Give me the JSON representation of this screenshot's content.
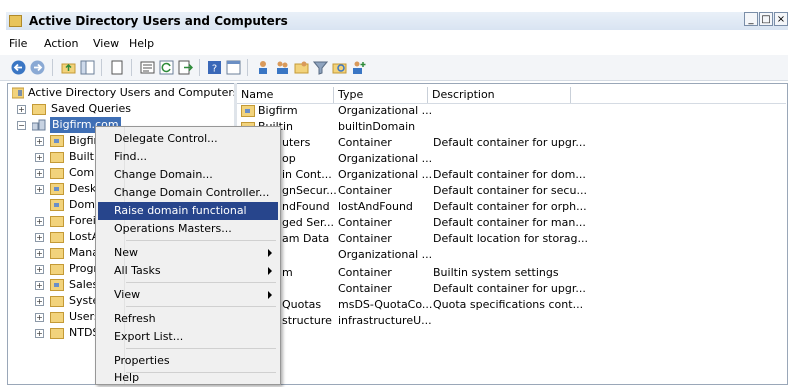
{
  "window": {
    "title": "Active Directory Users and Computers",
    "buttons": [
      "_",
      "□",
      "×"
    ]
  },
  "menubar": {
    "items": [
      "File",
      "Action",
      "View",
      "Help"
    ]
  },
  "toolbar": {
    "icons": [
      "back-arrow-icon",
      "forward-arrow-icon",
      "up-folder-icon",
      "show-console-tree-icon",
      "copy-icon",
      "properties-icon",
      "refresh-icon",
      "export-list-icon",
      "help-icon",
      "mmc-icon",
      "new-user-icon",
      "new-group-icon",
      "new-ou-icon",
      "filter-icon",
      "find-icon",
      "add-to-group-icon"
    ]
  },
  "tree": {
    "root": "Active Directory Users and Computers [BF",
    "saved_queries": "Saved Queries",
    "domain": "Bigfirm.com",
    "children": [
      "Bigfir",
      "Builtir",
      "Comp",
      "Deskt",
      "Doma",
      "Forei",
      "LostA",
      "Mana",
      "Progr",
      "Sales",
      "Syste",
      "Users",
      "NTDS"
    ]
  },
  "list": {
    "columns": {
      "name": "Name",
      "type": "Type",
      "description": "Description"
    },
    "rows": [
      {
        "name": "Bigfirm",
        "type": "Organizational ...",
        "description": ""
      },
      {
        "name": "Builtin",
        "type": "builtinDomain",
        "description": ""
      },
      {
        "name": "uters",
        "type": "Container",
        "description": "Default container for upgr..."
      },
      {
        "name": "op",
        "type": "Organizational ...",
        "description": ""
      },
      {
        "name": "in Cont...",
        "type": "Organizational ...",
        "description": "Default container for dom..."
      },
      {
        "name": "gnSecur...",
        "type": "Container",
        "description": "Default container for secu..."
      },
      {
        "name": "ndFound",
        "type": "lostAndFound",
        "description": "Default container for orph..."
      },
      {
        "name": "ged Ser...",
        "type": "Container",
        "description": "Default container for man..."
      },
      {
        "name": "am Data",
        "type": "Container",
        "description": "Default location for storag..."
      },
      {
        "name": "",
        "type": "Organizational ...",
        "description": ""
      },
      {
        "name": "m",
        "type": "Container",
        "description": "Builtin system settings"
      },
      {
        "name": "",
        "type": "Container",
        "description": "Default container for upgr..."
      },
      {
        "name": "Quotas",
        "type": "msDS-QuotaCo...",
        "description": "Quota specifications cont..."
      },
      {
        "name": "structure",
        "type": "infrastructureU...",
        "description": ""
      }
    ]
  },
  "context_menu": {
    "items": {
      "delegate": "Delegate Control...",
      "find": "Find...",
      "change_domain": "Change Domain...",
      "change_dc": "Change Domain Controller...",
      "raise": "Raise domain functional level...",
      "ops_masters": "Operations Masters...",
      "new": "New",
      "all_tasks": "All Tasks",
      "view": "View",
      "refresh": "Refresh",
      "export": "Export List...",
      "properties": "Properties",
      "help": "Help"
    }
  }
}
